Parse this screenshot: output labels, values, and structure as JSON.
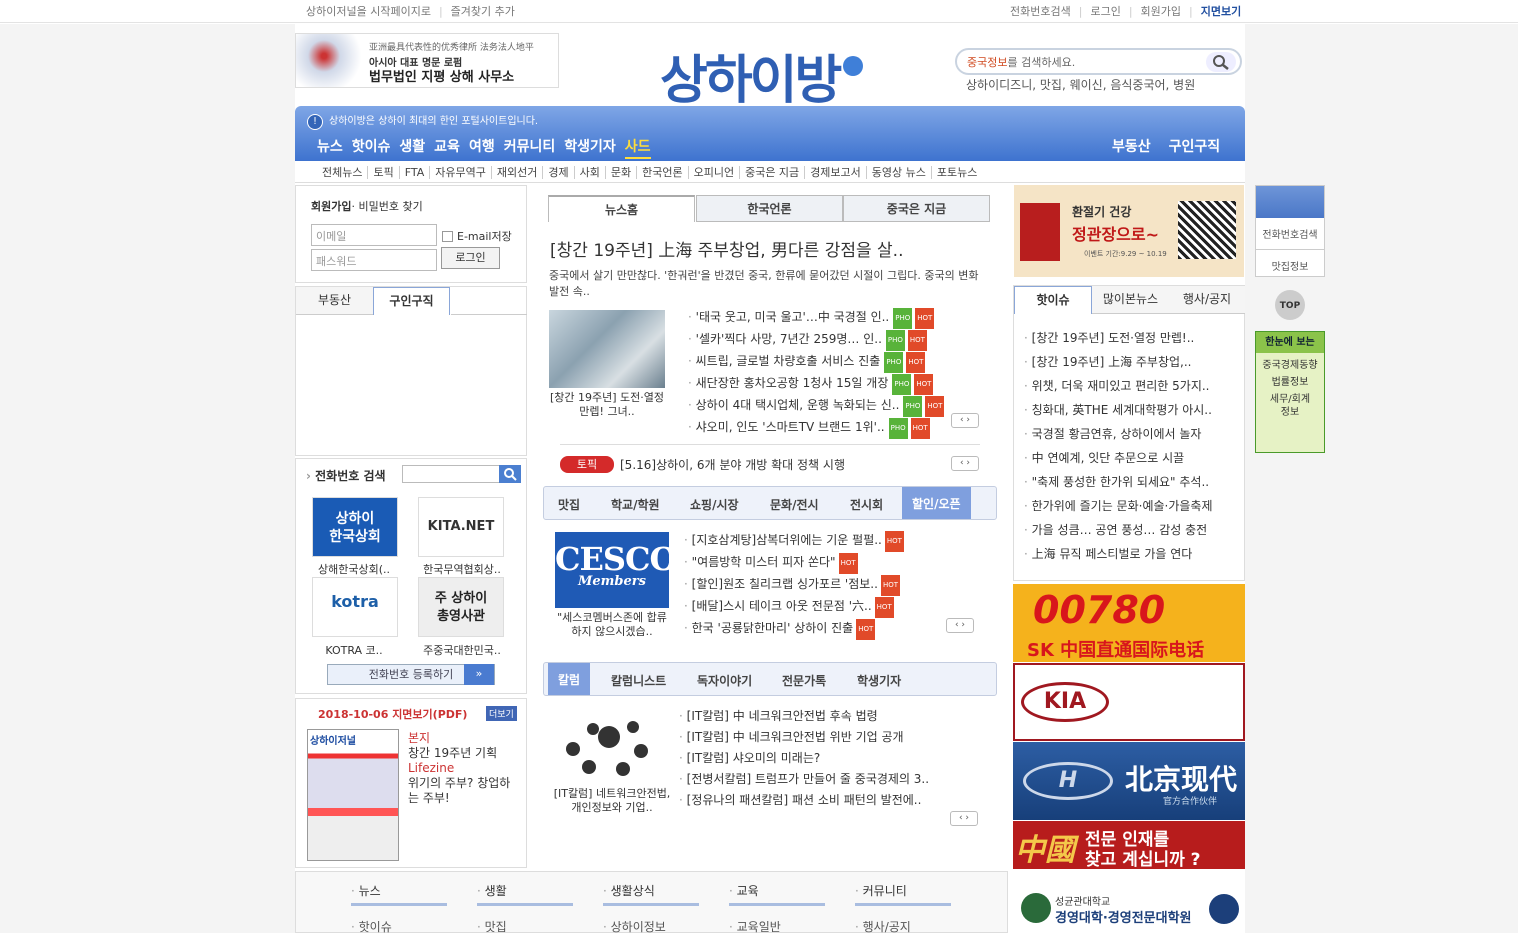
{
  "topbar": {
    "left": [
      "상하이저널을 시작페이지로",
      "즐겨찾기 추가"
    ],
    "right": [
      "전화번호검색",
      "로그인",
      "회원가입",
      "지면보기"
    ]
  },
  "header": {
    "ad_cn": "亚洲最具代表性的优秀律所 法务法人地平",
    "ad_kr1": "아시아 대표 명문 로펌",
    "ad_kr2": "법무법인 지평 상해 사무소",
    "logo": "상하이방",
    "search_placeholder_hl": "중국정보",
    "search_placeholder": "를 검색하세요.",
    "search_hint": "상하이디즈니, 맛집, 웨이신, 음식중국어, 병원"
  },
  "nav": {
    "info": "상하이방은 상하이 최대의 한인 포털사이트입니다.",
    "main": [
      "뉴스",
      "핫이슈",
      "생활",
      "교육",
      "여행",
      "커뮤니티",
      "학생기자",
      "사드"
    ],
    "right": [
      "부동산",
      "구인구직"
    ],
    "sub": [
      "전체뉴스",
      "토픽",
      "FTA",
      "자유무역구",
      "재외선거",
      "경제",
      "사회",
      "문화",
      "한국언론",
      "오피니언",
      "중국은 지금",
      "경제보고서",
      "동영상 뉴스",
      "포토뉴스"
    ]
  },
  "login": {
    "join": "회원가입",
    "find": "· 비밀번호 찾기",
    "email_ph": "이메일",
    "pw_ph": "패스워드",
    "save": "E-mail저장",
    "button": "로그인"
  },
  "tabs2": [
    "부동산",
    "구인구직"
  ],
  "phone": {
    "title": "전화번호 검색",
    "items": [
      {
        "logo": "상하이\n한국상회",
        "cap": "상해한국상회(.."
      },
      {
        "logo": "KITA.NET",
        "cap": "한국무역협회상.."
      },
      {
        "logo": "kotra",
        "cap": "KOTRA 코.."
      },
      {
        "logo": "주 상하이\n총영사관",
        "cap": "주중국대한민국.."
      }
    ],
    "register": "전화번호 등록하기"
  },
  "pdf": {
    "title": "2018-10-06 지면보기(PDF)",
    "more": "더보기",
    "l1": "본지",
    "l2": "창간 19주년 기획",
    "l3": "Lifezine",
    "l4": "위기의 주부? 창업하는 주부!",
    "paper_title": "상하이저널"
  },
  "center": {
    "tabs": [
      "뉴스홈",
      "한국언론",
      "중국은 지금"
    ],
    "headline": "[창간 19주년] 上海 주부창업, 男다른 강점을 살..",
    "lede": "중국에서 살기 만만찮다. '한궈런'을 반겼던 중국, 한류에 묻어갔던 시절이 그립다. 중국의 변화 발전 속..",
    "photo_cap": "[창간 19주년] 도전·열정 만렙! 그녀..",
    "news": [
      "'태국 웃고, 미국 울고'…中 국경절 인..",
      "'셀카'찍다 사망, 7년간 259명… 인..",
      "씨트립, 글로벌 차량호출 서비스 진출",
      "새단장한 홍차오공항 1청사 15일 개장",
      "상하이 4대 택시업체, 운행 녹화되는 신..",
      "샤오미, 인도 '스마트TV 브랜드 1위'.."
    ],
    "topic_tag": "토픽",
    "topic": "[5.16]상하이, 6개 분야 개방 확대 정책 시행",
    "cats": [
      "맛집",
      "학교/학원",
      "쇼핑/시장",
      "문화/전시",
      "전시회",
      "할인/오픈"
    ],
    "cesco_logo": "CESCO",
    "cesco_sub": "Members",
    "cesco_cap": "\"세스코멤버스존에 합류하지 않으시겠습..",
    "promo": [
      "[지호삼계탕]삼복더위에는 기운 펄펄..",
      "\"여름방학 미스터 피자 쏜다\"",
      "[할인]원조 칠리크랩 싱가포르 '점보..",
      "[배달]스시 테이크 아웃 전문점 '六..",
      "한국 '공룡닭한마리' 상하이 진출"
    ],
    "cats2": [
      "칼럼",
      "칼럼니스트",
      "독자이야기",
      "전문가톡",
      "학생기자"
    ],
    "col_cap": "[IT칼럼] 네트워크안전법, 개인정보와 기업..",
    "columns": [
      "[IT칼럼] 中 네크워크안전법 후속 법령",
      "[IT칼럼] 中 네크워크안전법 위반 기업 공개",
      "[IT칼럼] 샤오미의 미래는?",
      "[전병서칼럼] 트럼프가 만들어 줄 중국경제의 3..",
      "[정유나의 패션칼럼] 패션 소비 패턴의 발전에.."
    ]
  },
  "right": {
    "ad_jk": "환절기 건강",
    "ad_jk2": "정관장으로~",
    "ad_jk3": "이벤트 기간:9.29 ~ 10.19",
    "tabs": [
      "핫이슈",
      "많이본뉴스",
      "행사/공지"
    ],
    "hot": [
      "[창간 19주년] 도전·열정 만렙!..",
      "[창간 19주년] 上海 주부창업,..",
      "위챗, 더욱 재미있고 편리한 5가지..",
      "칭화대, 英THE 세계대학평가 아시..",
      "국경절 황금연휴, 상하이에서 놀자",
      "中 연예계, 잇단 추문으로 시끌",
      "\"축제 풍성한 한가위 되세요\" 추석..",
      "한가위에 즐기는 문화·예술·가을축제",
      "가을 성큼… 공연 풍성… 감성 충전",
      "上海 뮤직 페스티벌로 가을 연다"
    ],
    "ad_sk": "00780",
    "ad_sk2": "SK 中国直通国际电话",
    "ad_kia": "KIA",
    "ad_hy": "北京现代",
    "ad_hy2": "官方合作伙伴",
    "ad_job1": "中國",
    "ad_job2": "전문 인재를",
    "ad_job3": "찾고 계십니까 ?",
    "ad_skku1": "성균관대학교",
    "ad_skku2": "경영대학·경영전문대학원"
  },
  "far": {
    "phone": "전화번호검색",
    "food": "맛집정보",
    "top": "TOP",
    "t1": "한눈에 보는",
    "t2": "중국경제동향",
    "t3": "법률정보",
    "t4": "세무/회계",
    "t5": "정보"
  },
  "footer": {
    "heads": [
      "뉴스",
      "생활",
      "생활상식",
      "교육",
      "커뮤니티"
    ],
    "items": [
      "핫이슈",
      "맛집",
      "상하이정보",
      "교육일반",
      "행사/공지"
    ]
  },
  "colors": {
    "brand": "#2f5fb3",
    "nav": "#3e73cf",
    "hot": "#e14a29",
    "pho": "#58b33a",
    "topic": "#d42a2a"
  }
}
